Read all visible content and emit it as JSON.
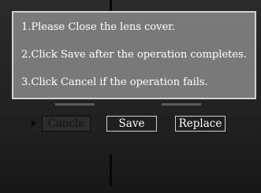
{
  "instructions": [
    "1.Please Close the lens cover.",
    "2.Click Save after the operation completes.",
    "3.Click Cancel if the operation fails."
  ],
  "buttons": {
    "cancel": "Cancle",
    "save": "Save",
    "replace": "Replace"
  },
  "selected_button": "cancel",
  "colors": {
    "dialog_bg": "#808080",
    "dialog_border": "#d2d2d2",
    "text": "#ffffff",
    "selected_text": "#111111"
  }
}
